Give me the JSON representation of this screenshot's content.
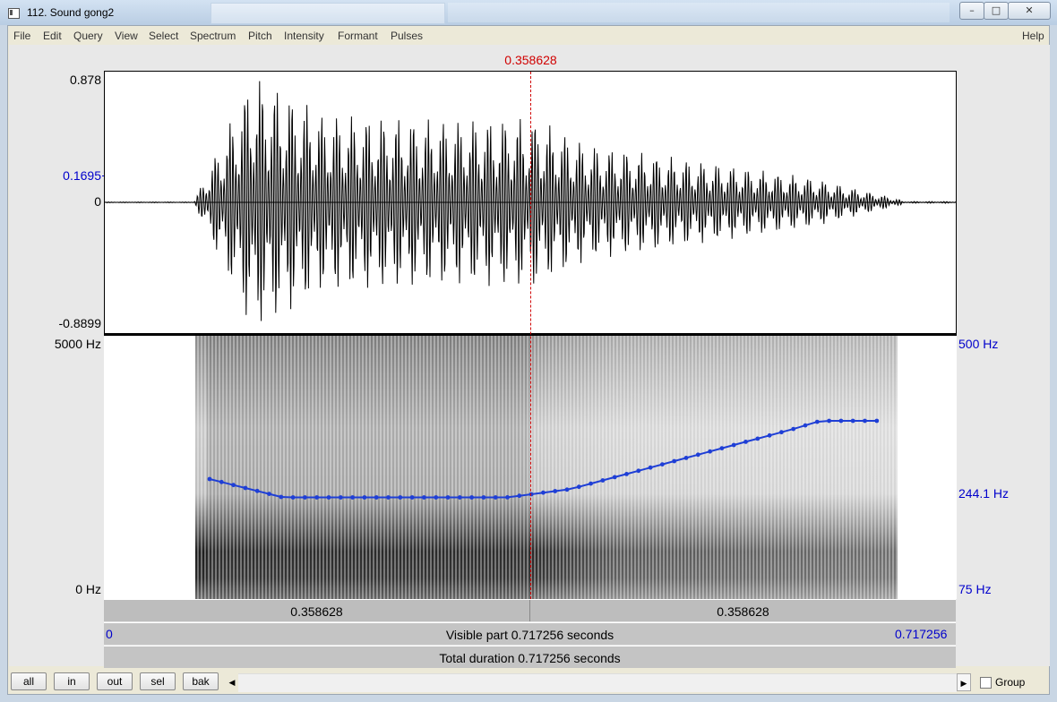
{
  "window": {
    "title": "112. Sound gong2",
    "controls": [
      "minimize-icon",
      "maximize-icon",
      "close-icon"
    ]
  },
  "menu": [
    "File",
    "Edit",
    "Query",
    "View",
    "Select",
    "Spectrum",
    "Pitch",
    "Intensity",
    "Formant",
    "Pulses"
  ],
  "help": "Help",
  "cursor": {
    "time": "0.358628"
  },
  "waveform": {
    "y_max": "0.878",
    "y_cursor_value": "0.1695",
    "y_zero": "0",
    "y_min": "-0.8899"
  },
  "spectrogram": {
    "freq_top": "5000 Hz",
    "freq_bottom": "0 Hz",
    "pitch_top": "500 Hz",
    "pitch_cursor": "244.1 Hz",
    "pitch_bottom": "75 Hz",
    "pitch_track_color": "#1f3fd6"
  },
  "timebar": {
    "left_segment": "0.358628",
    "right_segment": "0.358628",
    "visible_start": "0",
    "visible_text": "Visible part 0.717256 seconds",
    "visible_end": "0.717256",
    "total_text": "Total duration 0.717256 seconds"
  },
  "toolbar": {
    "buttons": [
      "all",
      "in",
      "out",
      "sel",
      "bak"
    ],
    "group_label": "Group",
    "group_checked": false
  }
}
